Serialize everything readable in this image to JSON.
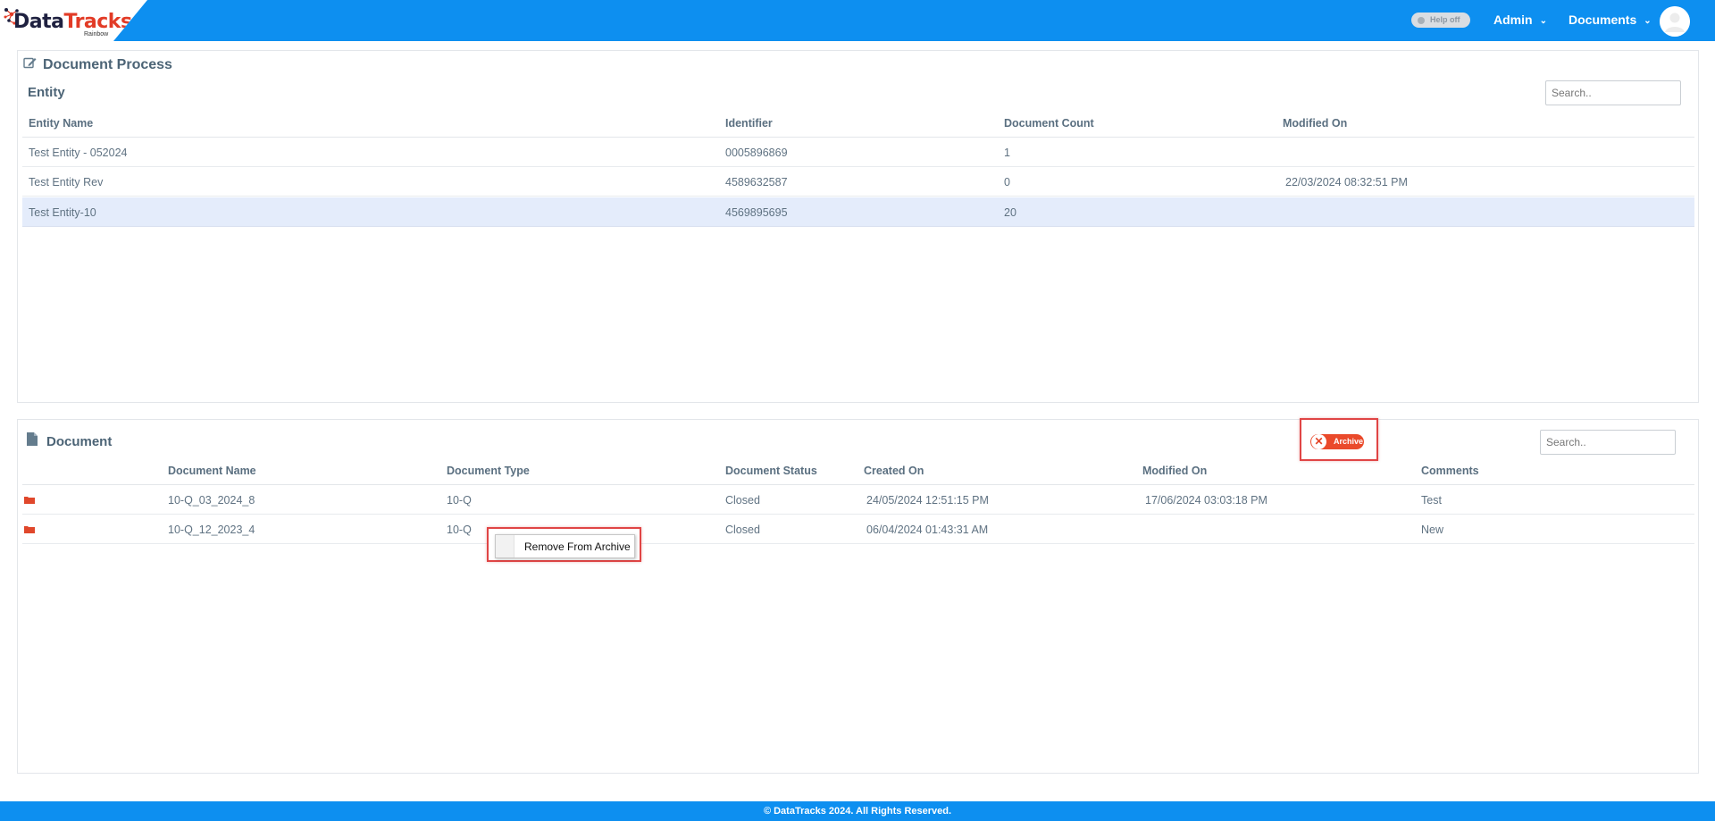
{
  "header": {
    "logo": {
      "brand_part1": "Data",
      "brand_part2": "Tracks",
      "sub": "Rainbow"
    },
    "help_toggle": "Help off",
    "nav": [
      {
        "label": "Admin"
      },
      {
        "label": "Documents"
      }
    ],
    "icons": {
      "avatar": "user-avatar-icon",
      "chevron": "chevron-down-icon"
    }
  },
  "entity_panel": {
    "title": "Document Process",
    "section": "Entity",
    "search_placeholder": "Search..",
    "columns": [
      "Entity Name",
      "Identifier",
      "Document Count",
      "Modified On"
    ],
    "rows": [
      {
        "name": "Test Entity - 052024",
        "identifier": "0005896869",
        "count": "1",
        "modified": ""
      },
      {
        "name": "Test Entity Rev",
        "identifier": "4589632587",
        "count": "0",
        "modified": "22/03/2024 08:32:51 PM"
      },
      {
        "name": "Test Entity-10",
        "identifier": "4569895695",
        "count": "20",
        "modified": "",
        "selected": true
      }
    ]
  },
  "document_panel": {
    "title": "Document",
    "archive_toggle": "Archive",
    "search_placeholder": "Search..",
    "columns": [
      "Document Name",
      "Document Type",
      "Document Status",
      "Created On",
      "Modified On",
      "Comments"
    ],
    "rows": [
      {
        "name": "10-Q_03_2024_8",
        "type": "10-Q",
        "status": "Closed",
        "created": "24/05/2024 12:51:15 PM",
        "modified": "17/06/2024 03:03:18 PM",
        "comments": "Test"
      },
      {
        "name": "10-Q_12_2023_4",
        "type": "10-Q",
        "status": "Closed",
        "created": "06/04/2024 01:43:31 AM",
        "modified": "",
        "comments": "New"
      }
    ],
    "context_menu": {
      "item": "Remove From Archive"
    }
  },
  "footer": {
    "text": "© DataTracks 2024. All Rights Reserved."
  },
  "colors": {
    "header_blue": "#0d8ff0",
    "archive_red": "#ea4a2b",
    "folder_red": "#e0472b",
    "highlight_red": "#e04545",
    "selected_row": "#e4ecfb"
  }
}
